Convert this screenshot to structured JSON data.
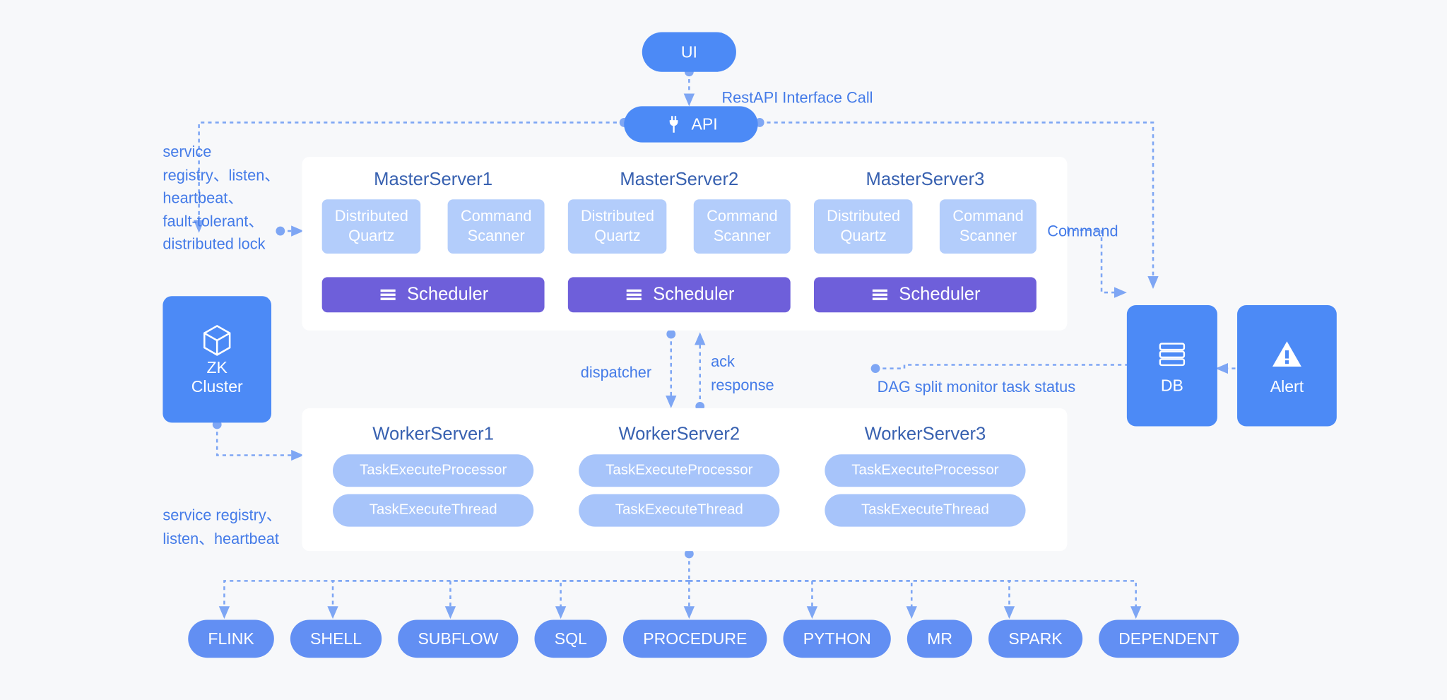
{
  "top": {
    "ui": "UI",
    "api": "API",
    "rest_label": "RestAPI Interface Call"
  },
  "zk": {
    "title1": "ZK",
    "title2": "Cluster",
    "label_top": "service\nregistry、listen、\nheartbeat、\nfault-tolerant、\ndistributed lock",
    "label_bottom": "service registry、\nlisten、heartbeat"
  },
  "masters": [
    {
      "title": "MasterServer1",
      "dq1": "Distributed",
      "dq2": "Quartz",
      "cs1": "Command",
      "cs2": "Scanner",
      "sched": "Scheduler"
    },
    {
      "title": "MasterServer2",
      "dq1": "Distributed",
      "dq2": "Quartz",
      "cs1": "Command",
      "cs2": "Scanner",
      "sched": "Scheduler"
    },
    {
      "title": "MasterServer3",
      "dq1": "Distributed",
      "dq2": "Quartz",
      "cs1": "Command",
      "cs2": "Scanner",
      "sched": "Scheduler"
    }
  ],
  "workers": [
    {
      "title": "WorkerServer1",
      "p1": "TaskExecuteProcessor",
      "p2": "TaskExecuteThread"
    },
    {
      "title": "WorkerServer2",
      "p1": "TaskExecuteProcessor",
      "p2": "TaskExecuteThread"
    },
    {
      "title": "WorkerServer3",
      "p1": "TaskExecuteProcessor",
      "p2": "TaskExecuteThread"
    }
  ],
  "db": {
    "label": "DB"
  },
  "alert": {
    "label": "Alert"
  },
  "mid_labels": {
    "dispatcher": "dispatcher",
    "ack": "ack\nresponse",
    "command": "Command",
    "dag": "DAG split monitor task status"
  },
  "tasks": [
    "FLINK",
    "SHELL",
    "SUBFLOW",
    "SQL",
    "PROCEDURE",
    "PYTHON",
    "MR",
    "SPARK",
    "DEPENDENT"
  ]
}
